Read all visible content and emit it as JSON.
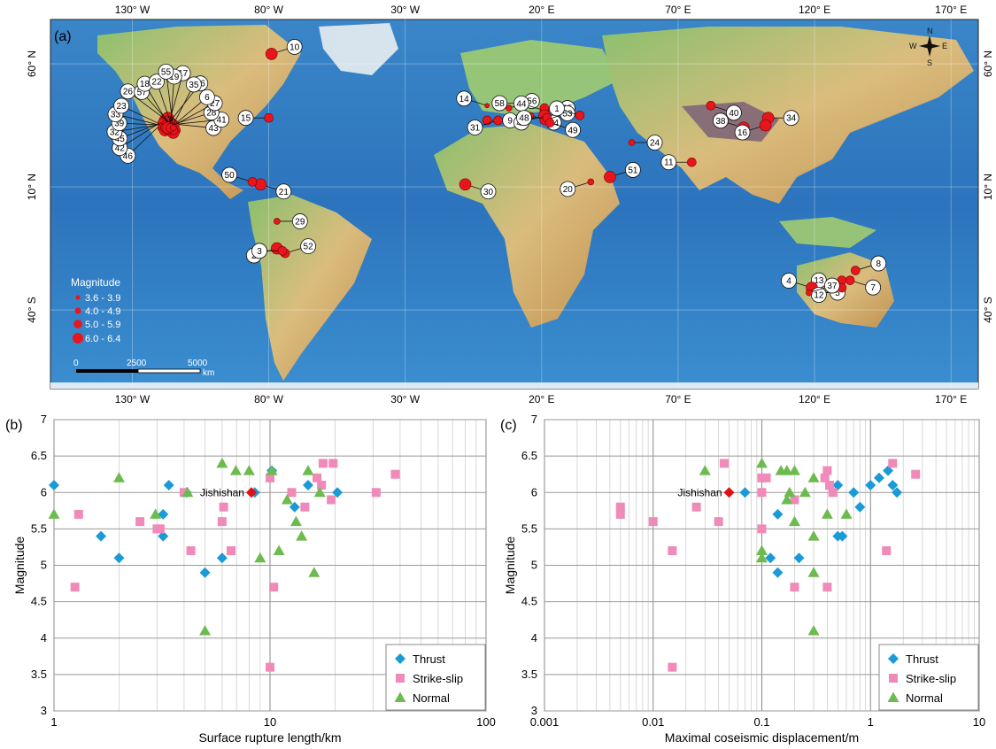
{
  "colors": {
    "thrust": "#1a9ad6",
    "strikeslip": "#f08ab8",
    "normal": "#6dbb4f",
    "jishishan": "#e01010",
    "event": "#e8161c",
    "ocean": "#2f7fc4",
    "land": "#e7c47c"
  },
  "map": {
    "panel_label": "(a)",
    "lon_ticks": [
      "130° W",
      "80° W",
      "30° W",
      "20° E",
      "70° E",
      "120° E",
      "170° E"
    ],
    "lat_ticks": [
      "60° N",
      "10° N",
      "40° S"
    ],
    "compass": {
      "n": "N",
      "s": "S",
      "e": "E",
      "w": "W"
    },
    "legend_title": "Magnitude",
    "legend_items": [
      "3.6 - 3.9",
      "4.0 - 4.9",
      "5.0 - 5.9",
      "6.0 - 6.4"
    ],
    "scale_labels": [
      "0",
      "2500",
      "5000",
      "km"
    ],
    "events": [
      {
        "id": "10",
        "lon": -79,
        "lat": 64,
        "mag": 6.0
      },
      {
        "id": "15",
        "lon": -80,
        "lat": 38,
        "mag": 5.8
      },
      {
        "id": "21",
        "lon": -83,
        "lat": 11,
        "mag": 6.2
      },
      {
        "id": "50",
        "lon": -86,
        "lat": 12,
        "mag": 5.6
      },
      {
        "id": "29",
        "lon": -77,
        "lat": -4,
        "mag": 4.5
      },
      {
        "id": "2",
        "lon": -77,
        "lat": -15,
        "mag": 6.1
      },
      {
        "id": "52",
        "lon": -74,
        "lat": -17,
        "mag": 5.5
      },
      {
        "id": "3",
        "lon": -75,
        "lat": -16,
        "mag": 5.3
      },
      {
        "id": "30",
        "lon": -8,
        "lat": 11,
        "mag": 6.0
      },
      {
        "id": "14",
        "lon": 0,
        "lat": 43,
        "mag": 3.8
      },
      {
        "id": "9",
        "lon": 0,
        "lat": 37,
        "mag": 5.9
      },
      {
        "id": "31",
        "lon": 4,
        "lat": 37,
        "mag": 5.7
      },
      {
        "id": "56",
        "lon": 8,
        "lat": 42,
        "mag": 4.5
      },
      {
        "id": "58",
        "lon": 13,
        "lat": 44,
        "mag": 5.8
      },
      {
        "id": "54",
        "lon": 16,
        "lat": 39,
        "mag": 4.2
      },
      {
        "id": "44",
        "lon": 21,
        "lat": 41,
        "mag": 5.3
      },
      {
        "id": "25",
        "lon": 21,
        "lat": 42,
        "mag": 5.7
      },
      {
        "id": "47",
        "lon": 21,
        "lat": 39,
        "mag": 6.0
      },
      {
        "id": "53",
        "lon": 21,
        "lat": 37,
        "mag": 5.9
      },
      {
        "id": "48",
        "lon": 22,
        "lat": 38,
        "mag": 5.5
      },
      {
        "id": "49",
        "lon": 23,
        "lat": 36,
        "mag": 5.1
      },
      {
        "id": "1",
        "lon": 34,
        "lat": 39,
        "mag": 5.0
      },
      {
        "id": "24",
        "lon": 53,
        "lat": 28,
        "mag": 4.7
      },
      {
        "id": "20",
        "lon": 38,
        "lat": 12,
        "mag": 4.8
      },
      {
        "id": "51",
        "lon": 45,
        "lat": 14,
        "mag": 6.0
      },
      {
        "id": "11",
        "lon": 75,
        "lat": 20,
        "mag": 5.9
      },
      {
        "id": "40",
        "lon": 82,
        "lat": 43,
        "mag": 5.3
      },
      {
        "id": "38",
        "lon": 94,
        "lat": 34,
        "mag": 6.0
      },
      {
        "id": "34",
        "lon": 103,
        "lat": 38,
        "mag": 6.2
      },
      {
        "id": "16",
        "lon": 102,
        "lat": 35,
        "mag": 6.0
      },
      {
        "id": "8",
        "lon": 135,
        "lat": -24,
        "mag": 5.7
      },
      {
        "id": "13",
        "lon": 130,
        "lat": -28,
        "mag": 5.9
      },
      {
        "id": "7",
        "lon": 133,
        "lat": -28,
        "mag": 5.6
      },
      {
        "id": "4",
        "lon": 119,
        "lat": -31,
        "mag": 6.0
      },
      {
        "id": "5",
        "lon": 120,
        "lat": -33,
        "mag": 4.6
      },
      {
        "id": "12",
        "lon": 130,
        "lat": -31,
        "mag": 5.4
      },
      {
        "id": "37",
        "lon": 118,
        "lat": -33,
        "mag": 4.3
      },
      {
        "id": "46",
        "lon": -118,
        "lat": 37,
        "mag": 6.0
      },
      {
        "id": "42",
        "lon": -117,
        "lat": 38,
        "mag": 6.2
      },
      {
        "id": "45",
        "lon": -117,
        "lat": 37,
        "mag": 5.9
      },
      {
        "id": "32",
        "lon": -116,
        "lat": 36,
        "mag": 6.1
      },
      {
        "id": "39",
        "lon": -116,
        "lat": 35,
        "mag": 5.5
      },
      {
        "id": "43",
        "lon": -119,
        "lat": 36,
        "mag": 5.7
      },
      {
        "id": "41",
        "lon": -118,
        "lat": 35,
        "mag": 5.4
      },
      {
        "id": "33",
        "lon": -116,
        "lat": 34,
        "mag": 6.0
      },
      {
        "id": "23",
        "lon": -117,
        "lat": 34,
        "mag": 5.8
      },
      {
        "id": "28",
        "lon": -119,
        "lat": 34,
        "mag": 5.2
      },
      {
        "id": "26",
        "lon": -115,
        "lat": 35,
        "mag": 6.1
      },
      {
        "id": "27",
        "lon": -118,
        "lat": 33,
        "mag": 6.0
      },
      {
        "id": "57",
        "lon": -114,
        "lat": 33,
        "mag": 5.9
      },
      {
        "id": "6",
        "lon": -117,
        "lat": 33,
        "mag": 5.6
      },
      {
        "id": "18",
        "lon": -115,
        "lat": 32,
        "mag": 6.3
      },
      {
        "id": "36",
        "lon": -118,
        "lat": 34,
        "mag": 5.0
      },
      {
        "id": "35",
        "lon": -116,
        "lat": 33,
        "mag": 5.4
      },
      {
        "id": "22",
        "lon": -115,
        "lat": 33,
        "mag": 5.7
      },
      {
        "id": "17",
        "lon": -117,
        "lat": 34,
        "mag": 6.0
      },
      {
        "id": "19",
        "lon": -116,
        "lat": 34,
        "mag": 5.8
      },
      {
        "id": "55",
        "lon": -115,
        "lat": 34,
        "mag": 4.9
      }
    ]
  },
  "chart_data": [
    {
      "type": "scatter",
      "panel_label": "(b)",
      "xlabel": "Surface rupture length/km",
      "ylabel": "Magnitude",
      "xscale": "log",
      "xlim": [
        1,
        100
      ],
      "ylim": [
        3,
        7
      ],
      "x_tick_labels": [
        "1",
        "10",
        "100"
      ],
      "y_tick_labels": [
        "3",
        "3.5",
        "4",
        "4.5",
        "5",
        "5.5",
        "6",
        "6.5",
        "7"
      ],
      "grid": true,
      "legend_position": "bottom-right",
      "annotation": "Jishishan",
      "annotation_point": {
        "x": 8.2,
        "y": 6.0
      },
      "series": [
        {
          "name": "Thrust",
          "marker": "diamond",
          "points": [
            [
              1.0,
              6.1
            ],
            [
              1.65,
              5.4
            ],
            [
              2.0,
              5.1
            ],
            [
              3.2,
              5.7
            ],
            [
              3.2,
              5.4
            ],
            [
              3.4,
              6.1
            ],
            [
              4.1,
              6.0
            ],
            [
              5.0,
              4.9
            ],
            [
              6.0,
              5.1
            ],
            [
              8.5,
              6.0
            ],
            [
              10.2,
              6.3
            ],
            [
              13.0,
              5.8
            ],
            [
              15.0,
              6.1
            ],
            [
              20.5,
              6.0
            ]
          ]
        },
        {
          "name": "Strike-slip",
          "marker": "square",
          "points": [
            [
              1.25,
              4.7
            ],
            [
              1.3,
              5.7
            ],
            [
              2.5,
              5.6
            ],
            [
              3.0,
              5.5
            ],
            [
              3.1,
              5.5
            ],
            [
              4.0,
              6.0
            ],
            [
              4.3,
              5.2
            ],
            [
              6.0,
              5.6
            ],
            [
              6.1,
              5.8
            ],
            [
              6.6,
              5.2
            ],
            [
              10.0,
              3.6
            ],
            [
              10.0,
              6.2
            ],
            [
              10.4,
              4.7
            ],
            [
              12.6,
              6.0
            ],
            [
              14.5,
              5.8
            ],
            [
              16.5,
              6.2
            ],
            [
              17.3,
              6.1
            ],
            [
              17.6,
              6.4
            ],
            [
              19.2,
              5.9
            ],
            [
              19.6,
              6.4
            ],
            [
              31.0,
              6.0
            ],
            [
              38.0,
              6.25
            ]
          ]
        },
        {
          "name": "Normal",
          "marker": "triangle",
          "points": [
            [
              1.0,
              5.7
            ],
            [
              2.0,
              6.2
            ],
            [
              2.95,
              5.7
            ],
            [
              4.15,
              6.0
            ],
            [
              5.0,
              4.1
            ],
            [
              6.0,
              6.4
            ],
            [
              6.95,
              6.3
            ],
            [
              8.0,
              6.3
            ],
            [
              9.0,
              5.1
            ],
            [
              10.2,
              6.3
            ],
            [
              11.0,
              5.2
            ],
            [
              12.0,
              5.9
            ],
            [
              13.2,
              5.6
            ],
            [
              14.0,
              5.4
            ],
            [
              15.0,
              6.3
            ],
            [
              16.0,
              4.9
            ],
            [
              17.0,
              6.0
            ]
          ]
        }
      ]
    },
    {
      "type": "scatter",
      "panel_label": "(c)",
      "xlabel": "Maximal coseismic displacement/m",
      "ylabel": "Magnitude",
      "xscale": "log",
      "xlim": [
        0.001,
        10
      ],
      "ylim": [
        3,
        7
      ],
      "x_tick_labels": [
        "0.001",
        "0.01",
        "0.1",
        "1",
        "10"
      ],
      "y_tick_labels": [
        "3",
        "3.5",
        "4",
        "4.5",
        "5",
        "5.5",
        "6",
        "6.5",
        "7"
      ],
      "grid": true,
      "legend_position": "bottom-right",
      "annotation": "Jishishan",
      "annotation_point": {
        "x": 0.05,
        "y": 6.0
      },
      "series": [
        {
          "name": "Thrust",
          "marker": "diamond",
          "points": [
            [
              0.07,
              6.0
            ],
            [
              0.12,
              5.1
            ],
            [
              0.14,
              4.9
            ],
            [
              0.14,
              5.7
            ],
            [
              0.22,
              5.1
            ],
            [
              0.5,
              6.1
            ],
            [
              0.5,
              5.4
            ],
            [
              0.55,
              5.4
            ],
            [
              0.7,
              6.0
            ],
            [
              0.8,
              5.8
            ],
            [
              1.0,
              6.1
            ],
            [
              1.2,
              6.2
            ],
            [
              1.45,
              6.3
            ],
            [
              1.6,
              6.1
            ],
            [
              1.75,
              6.0
            ]
          ]
        },
        {
          "name": "Strike-slip",
          "marker": "square",
          "points": [
            [
              0.005,
              5.8
            ],
            [
              0.005,
              5.7
            ],
            [
              0.01,
              5.6
            ],
            [
              0.015,
              5.2
            ],
            [
              0.015,
              3.6
            ],
            [
              0.025,
              5.8
            ],
            [
              0.04,
              5.6
            ],
            [
              0.045,
              6.4
            ],
            [
              0.1,
              6.2
            ],
            [
              0.1,
              6.0
            ],
            [
              0.1,
              5.5
            ],
            [
              0.11,
              6.2
            ],
            [
              0.2,
              4.7
            ],
            [
              0.2,
              5.9
            ],
            [
              0.38,
              6.2
            ],
            [
              0.4,
              6.3
            ],
            [
              0.4,
              4.7
            ],
            [
              0.42,
              6.1
            ],
            [
              0.45,
              6.0
            ],
            [
              1.4,
              5.2
            ],
            [
              1.6,
              6.4
            ],
            [
              2.6,
              6.25
            ]
          ]
        },
        {
          "name": "Normal",
          "marker": "triangle",
          "points": [
            [
              0.03,
              6.3
            ],
            [
              0.1,
              6.4
            ],
            [
              0.1,
              5.2
            ],
            [
              0.1,
              5.1
            ],
            [
              0.15,
              6.3
            ],
            [
              0.17,
              6.3
            ],
            [
              0.17,
              5.9
            ],
            [
              0.18,
              6.0
            ],
            [
              0.2,
              5.6
            ],
            [
              0.2,
              6.3
            ],
            [
              0.25,
              6.0
            ],
            [
              0.3,
              6.2
            ],
            [
              0.3,
              5.4
            ],
            [
              0.3,
              4.9
            ],
            [
              0.3,
              4.1
            ],
            [
              0.4,
              5.7
            ],
            [
              0.6,
              5.7
            ]
          ]
        }
      ]
    }
  ]
}
